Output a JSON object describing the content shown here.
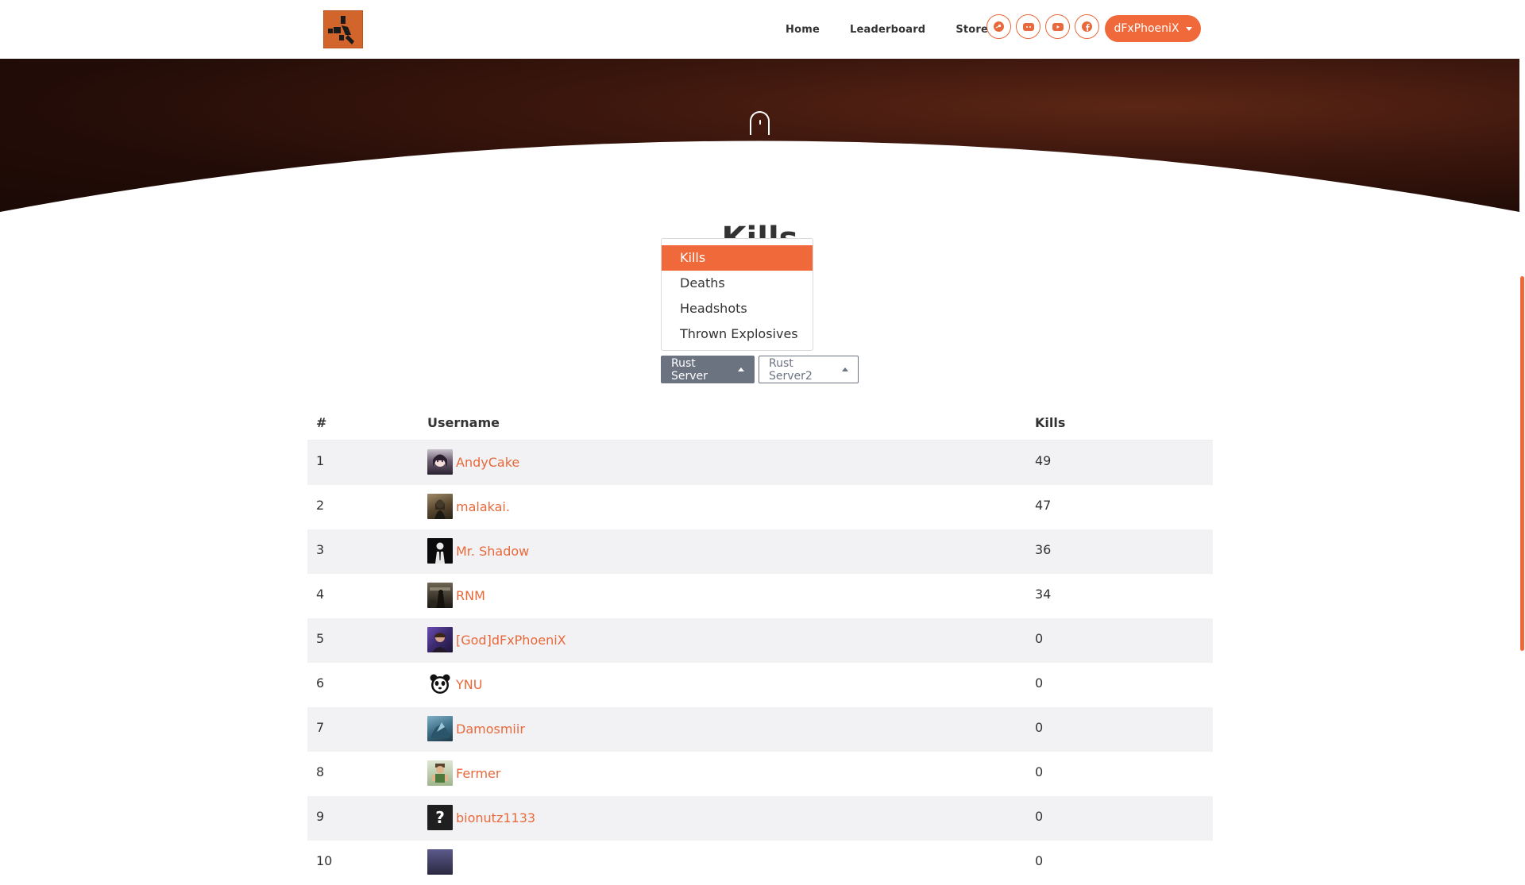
{
  "nav": {
    "links": [
      "Home",
      "Leaderboard",
      "Store"
    ],
    "social_icons": [
      "steam-icon",
      "discord-icon",
      "youtube-icon",
      "facebook-icon"
    ],
    "user_label": "dFxPhoeniX"
  },
  "colors": {
    "accent": "#f0693a",
    "logo": "#d2652c",
    "secondary_button": "#6b7280",
    "stripe": "#f2f2f4"
  },
  "stat": {
    "title": "Kills",
    "options": [
      "Kills",
      "Deaths",
      "Headshots",
      "Thrown Explosives"
    ],
    "selected": "Kills"
  },
  "servers": {
    "active": "Rust Server",
    "other": "Rust Server2"
  },
  "table": {
    "headers": {
      "rank": "#",
      "username": "Username",
      "kills": "Kills"
    },
    "rows": [
      {
        "rank": "1",
        "name": "AndyCake",
        "kills": "49"
      },
      {
        "rank": "2",
        "name": "malakai.",
        "kills": "47"
      },
      {
        "rank": "3",
        "name": "Mr. Shadow",
        "kills": "36"
      },
      {
        "rank": "4",
        "name": "RNM",
        "kills": "34"
      },
      {
        "rank": "5",
        "name": "[God]dFxPhoeniX",
        "kills": "0"
      },
      {
        "rank": "6",
        "name": "YNU",
        "kills": "0"
      },
      {
        "rank": "7",
        "name": "Damosmiir",
        "kills": "0"
      },
      {
        "rank": "8",
        "name": "Fermer",
        "kills": "0"
      },
      {
        "rank": "9",
        "name": "bionutz1133",
        "kills": "0"
      },
      {
        "rank": "10",
        "name": "",
        "kills": "0"
      }
    ]
  }
}
